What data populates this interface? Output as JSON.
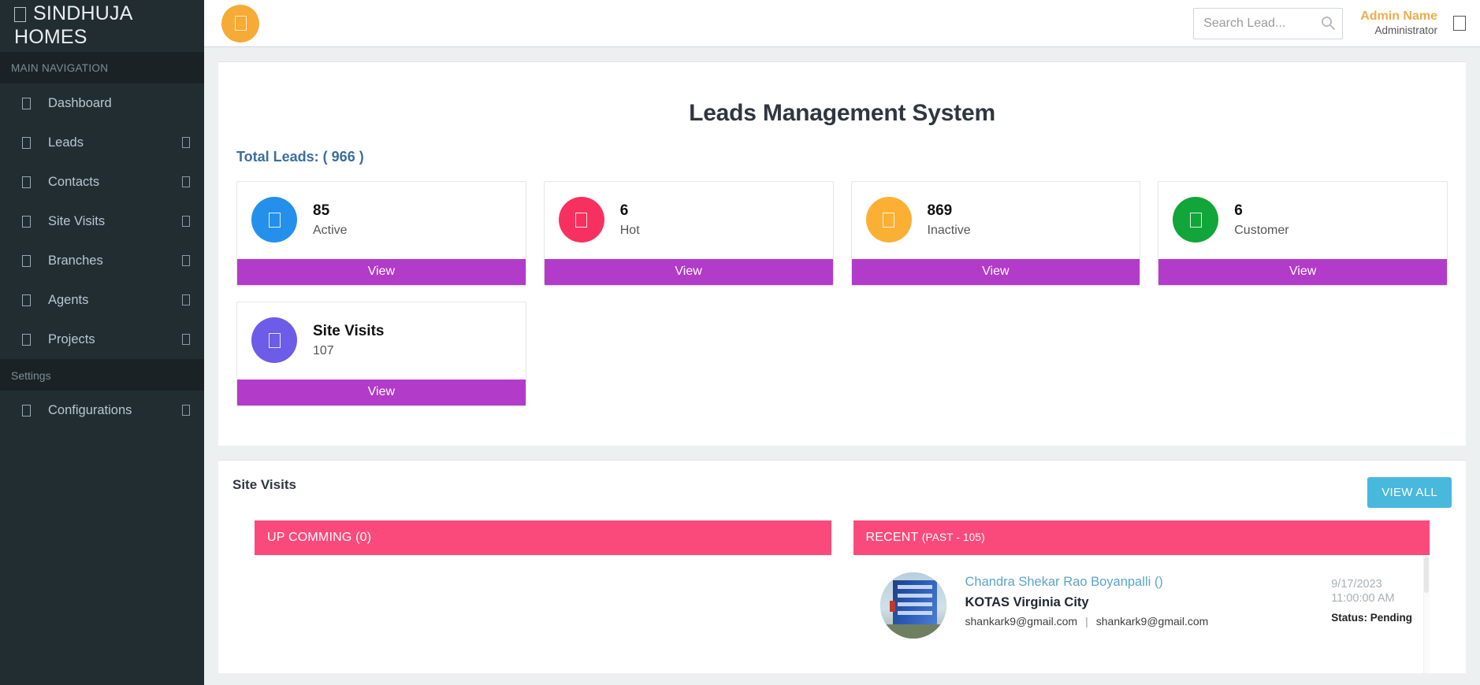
{
  "sidebar": {
    "logo": "SINDHUJA HOMES",
    "logo_icon": "home-icon",
    "nav_header": "MAIN NAVIGATION",
    "items": [
      {
        "label": "Dashboard",
        "icon": "dashboard-icon",
        "caret": false
      },
      {
        "label": "Leads",
        "icon": "users-icon",
        "caret": true
      },
      {
        "label": "Contacts",
        "icon": "contacts-icon",
        "caret": true
      },
      {
        "label": "Site Visits",
        "icon": "calendar-icon",
        "caret": true
      },
      {
        "label": "Branches",
        "icon": "branch-icon",
        "caret": true
      },
      {
        "label": "Agents",
        "icon": "agent-icon",
        "caret": true
      },
      {
        "label": "Projects",
        "icon": "projects-icon",
        "caret": true
      }
    ],
    "settings_header": "Settings",
    "settings_items": [
      {
        "label": "Configurations",
        "icon": "gear-icon",
        "caret": true
      }
    ]
  },
  "topbar": {
    "menu_toggle_icon": "hamburger-icon",
    "search": {
      "value": "",
      "placeholder": "Search Lead...",
      "icon": "search-icon"
    },
    "user": {
      "name": "Admin Name",
      "role": "Administrator",
      "caret_icon": "chevron-down-icon"
    }
  },
  "main": {
    "title": "Leads Management System",
    "total_leads_label": "Total Leads: ( 966 )",
    "stat_cards": [
      {
        "value": "85",
        "label": "Active",
        "color": "#2490eb",
        "action": "View",
        "icon": "user-check-icon"
      },
      {
        "value": "6",
        "label": "Hot",
        "color": "#f7315f",
        "action": "View",
        "icon": "fire-icon"
      },
      {
        "value": "869",
        "label": "Inactive",
        "color": "#fbb034",
        "action": "View",
        "icon": "user-slash-icon"
      },
      {
        "value": "6",
        "label": "Customer",
        "color": "#12a53a",
        "action": "View",
        "icon": "user-tie-icon"
      }
    ],
    "site_visit_card": {
      "title": "Site Visits",
      "value": "107",
      "color": "#6c5ce7",
      "action": "View",
      "icon": "map-marker-icon"
    },
    "accent_view_button_color": "#b23bc9"
  },
  "visits_section": {
    "title": "Site Visits",
    "view_all_label": "VIEW ALL",
    "view_all_color": "#48b8dd",
    "header_color": "#fa4a7b",
    "upcoming": {
      "title": "UP COMMING",
      "count": "(0)",
      "rows": []
    },
    "recent": {
      "title": "RECENT",
      "count": "(PAST - 105)",
      "rows": [
        {
          "person": "Chandra Shekar Rao Boyanpalli ()",
          "project": "KOTAS Virginia City",
          "email_primary": "shankark9@gmail.com",
          "separator": "|",
          "email_secondary": "shankark9@gmail.com",
          "date": "9/17/2023",
          "time": "11:00:00 AM",
          "status": "Status: Pending",
          "thumbnail_icon": "building-photo"
        }
      ]
    }
  }
}
